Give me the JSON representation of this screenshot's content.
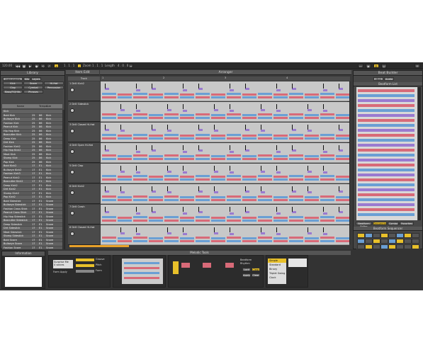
{
  "colors": {
    "accent": "#e8c02a",
    "blue": "#6a9fd4",
    "red": "#d86a78",
    "purple": "#9a7ad0",
    "bg": "#3b3b3b"
  },
  "topbar": {
    "tempo": "120.00",
    "pos1": "1 . 1 . 1",
    "zoom": "Zoom",
    "pos2": "1 . 1 . 1",
    "length_label": "Length",
    "pos3": "4 . 0 . 0"
  },
  "library": {
    "title": "Library",
    "filters": [
      "Instruments",
      "Kits",
      "Layers",
      "Kick",
      "Snare",
      "Hi-Hat",
      "Clap",
      "Cymbal",
      "Percussion",
      "Bass/FX/Hits",
      "Phrases"
    ],
    "columns": [
      "Name",
      "Tempo",
      "Size"
    ],
    "rows": [
      [
        "Kick",
        "",
        "",
        ""
      ],
      [
        "Bold Kick",
        "25",
        "86",
        "Kick"
      ],
      [
        "Bullseye Kick",
        "25",
        "86",
        "Kick"
      ],
      [
        "Fashion Kick",
        "25",
        "86",
        "Kick"
      ],
      [
        "Peanut Kick",
        "25",
        "86",
        "Kick"
      ],
      [
        "Hip Hop Kick",
        "25",
        "86",
        "Kick"
      ],
      [
        "Boxcutter Kick",
        "25",
        "86",
        "Kick"
      ],
      [
        "Deep Kick",
        "25",
        "86",
        "Kick"
      ],
      [
        "Dirt Kick",
        "25",
        "86",
        "Kick"
      ],
      [
        "Fashion Kick2",
        "25",
        "86",
        "Kick"
      ],
      [
        "Hip Hop Kick2",
        "25",
        "86",
        "Kick"
      ],
      [
        "Meat Kick",
        "25",
        "86",
        "Kick"
      ],
      [
        "Stomp Kick",
        "25",
        "86",
        "Kick"
      ],
      [
        "Pop Kick",
        "25",
        "86",
        "Kick"
      ],
      [
        "Bold Kick2",
        "17",
        "E1",
        "Kick"
      ],
      [
        "Bullseye Kick2",
        "17",
        "E1",
        "Kick"
      ],
      [
        "Fashion Kick3",
        "17",
        "E1",
        "Kick"
      ],
      [
        "Peanut Kick2",
        "17",
        "E1",
        "Kick"
      ],
      [
        "Boxcutter Kick2",
        "17",
        "E1",
        "Kick"
      ],
      [
        "Deep Kick2",
        "17",
        "E1",
        "Kick"
      ],
      [
        "Dirt Kick2",
        "17",
        "E1",
        "Kick"
      ],
      [
        "Stomp Kick2",
        "17",
        "E1",
        "Kick"
      ],
      [
        "Pop Kick2",
        "17",
        "E1",
        "Kick"
      ],
      [
        "Bold Sidestick",
        "17",
        "E1",
        "Snare"
      ],
      [
        "Bullseye Sidestick",
        "17",
        "E1",
        "Snare"
      ],
      [
        "Fashion Cross Stick",
        "17",
        "E1",
        "Snare"
      ],
      [
        "Peanut Cross Stick",
        "17",
        "E1",
        "Snare"
      ],
      [
        "Hip Hop Sidestick",
        "17",
        "E1",
        "Snare"
      ],
      [
        "Boxcutter Sidestick",
        "17",
        "E1",
        "Snare"
      ],
      [
        "Deep Sidestick",
        "17",
        "E1",
        "Snare"
      ],
      [
        "Dirt Sidestick",
        "17",
        "E1",
        "Snare"
      ],
      [
        "Meat Sidestick",
        "17",
        "E1",
        "Snare"
      ],
      [
        "Stomp Sidestick",
        "17",
        "E1",
        "Snare"
      ],
      [
        "Bold Snare",
        "17",
        "E1",
        "Snare"
      ],
      [
        "Bullseye Snare",
        "17",
        "E1",
        "Snare"
      ],
      [
        "Fashion Snare",
        "17",
        "E1",
        "Snare"
      ],
      [
        "Peanut Snare",
        "17",
        "E1",
        "Snare"
      ]
    ],
    "footer": "Instrument Folder"
  },
  "editor": {
    "title": "Item Edit",
    "track_header": "Track",
    "arranger": "Arranger",
    "markers": [
      "1",
      "2",
      "3",
      "4"
    ]
  },
  "tracks": [
    "1 Drill Kick2",
    "2 Drill Sidestick",
    "3 Drill Closed Hi-Hat",
    "4 Drill Open Hi-Hat",
    "5 Drill Clap",
    "6 Drill Kick2",
    "7 Drill Crash",
    "8 Drill Closed Hi-Hat"
  ],
  "beatbuilder": {
    "title": "Beat Builder",
    "tabs": [
      "Midi",
      "Audio"
    ],
    "subtitle": "Beatform List",
    "btns": [
      "Beatform Editor",
      "Sequencer",
      "Combo",
      "Favorites"
    ],
    "seq_title": "Beatform Sequencer",
    "seq_btns": [
      "Add",
      "Surprise Me",
      "Clear",
      "Sequencer"
    ]
  },
  "bottom": {
    "info_title": "Information",
    "melody_title": "Melodic Tools",
    "surprise": "Surprise Me\n4 voices",
    "form_apply": "Form Apply",
    "labels": [
      "Groove",
      "Pitch",
      "Form"
    ],
    "radio": [
      "Beatform",
      "Rhythm"
    ],
    "btns1": [
      "Lock",
      "Clear"
    ],
    "btns2": [
      "Apply",
      "Clear"
    ],
    "list": [
      "Simple",
      "Standard",
      "Binary",
      "Triplet Swing",
      "Clock"
    ]
  }
}
